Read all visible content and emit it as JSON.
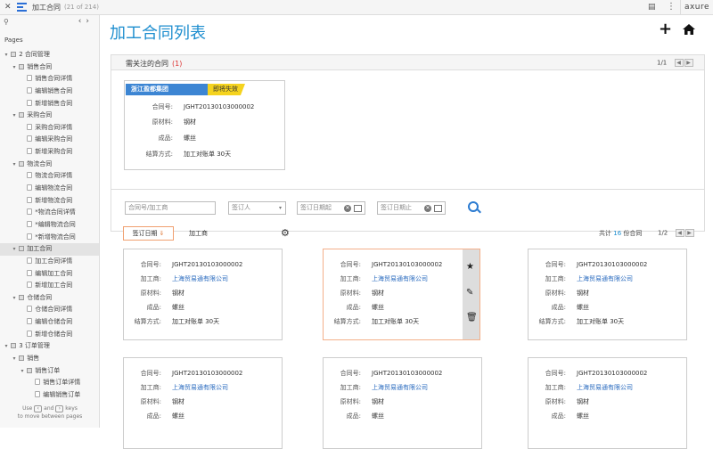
{
  "topbar": {
    "close_icon": "close-icon",
    "title": "加工合同",
    "count": "(21 of 214)",
    "brand": "axure"
  },
  "sidebar": {
    "pages_label": "Pages",
    "tree": [
      {
        "label": "2 合同管理",
        "level": 0,
        "type": "folder"
      },
      {
        "label": "销售合同",
        "level": 1,
        "type": "folder"
      },
      {
        "label": "销售合同详情",
        "level": 2,
        "type": "page"
      },
      {
        "label": "编辑销售合同",
        "level": 2,
        "type": "page"
      },
      {
        "label": "新增销售合同",
        "level": 2,
        "type": "page"
      },
      {
        "label": "采购合同",
        "level": 1,
        "type": "folder"
      },
      {
        "label": "采购合同详情",
        "level": 2,
        "type": "page"
      },
      {
        "label": "编辑采购合同",
        "level": 2,
        "type": "page"
      },
      {
        "label": "新增采购合同",
        "level": 2,
        "type": "page"
      },
      {
        "label": "物流合同",
        "level": 1,
        "type": "folder"
      },
      {
        "label": "物流合同详情",
        "level": 2,
        "type": "page"
      },
      {
        "label": "编辑物流合同",
        "level": 2,
        "type": "page"
      },
      {
        "label": "新增物流合同",
        "level": 2,
        "type": "page"
      },
      {
        "label": "*物流合同详情",
        "level": 2,
        "type": "page"
      },
      {
        "label": "*编辑物流合同",
        "level": 2,
        "type": "page"
      },
      {
        "label": "*新增物流合同",
        "level": 2,
        "type": "page"
      },
      {
        "label": "加工合同",
        "level": 1,
        "type": "folder",
        "selected": true
      },
      {
        "label": "加工合同详情",
        "level": 2,
        "type": "page"
      },
      {
        "label": "编辑加工合同",
        "level": 2,
        "type": "page"
      },
      {
        "label": "新增加工合同",
        "level": 2,
        "type": "page"
      },
      {
        "label": "仓储合同",
        "level": 1,
        "type": "folder"
      },
      {
        "label": "仓储合同详情",
        "level": 2,
        "type": "page"
      },
      {
        "label": "编辑仓储合同",
        "level": 2,
        "type": "page"
      },
      {
        "label": "新增仓储合同",
        "level": 2,
        "type": "page"
      },
      {
        "label": "3 订单管理",
        "level": 0,
        "type": "folder"
      },
      {
        "label": "销售",
        "level": 1,
        "type": "folder"
      },
      {
        "label": "销售订单",
        "level": 2,
        "type": "folder"
      },
      {
        "label": "销售订单详情",
        "level": 3,
        "type": "page"
      },
      {
        "label": "编辑销售订单",
        "level": 3,
        "type": "page"
      }
    ],
    "footer_use": "Use",
    "footer_and": "and",
    "footer_keys": "keys",
    "footer_line2": "to move between pages"
  },
  "main": {
    "title": "加工合同列表",
    "add_icon": "plus-icon",
    "home_icon": "home-icon",
    "attention": {
      "title": "需关注的合同",
      "count": "(1)",
      "page": "1/1",
      "card": {
        "company": "浙江盈都集团",
        "status": "即将失效",
        "rows": [
          {
            "label": "合同号:",
            "value": "JGHT20130103000002"
          },
          {
            "label": "原材料:",
            "value": "钢材"
          },
          {
            "label": "成品:",
            "value": "螺丝"
          },
          {
            "label": "结算方式:",
            "value": "加工对账单   30天"
          }
        ]
      }
    },
    "filters": {
      "contract_placeholder": "合同号/加工商",
      "signer_placeholder": "签订人",
      "date_start_placeholder": "签订日期起",
      "date_end_placeholder": "签订日期止"
    },
    "sort": {
      "sort_date": "签订日期",
      "sort_arrow": "⇓",
      "sort_vendor": "加工商",
      "total_prefix": "共计",
      "total_count": "16",
      "total_suffix": "份合同",
      "page": "1/2"
    },
    "cards": [
      {
        "contract": "JGHT20130103000002",
        "vendor": "上海贸易通有限公司",
        "material": "钢材",
        "product": "螺丝",
        "settlement": "加工对账单   30天"
      },
      {
        "contract": "JGHT20130103000002",
        "vendor": "上海贸易通有限公司",
        "material": "钢材",
        "product": "螺丝",
        "settlement": "加工对账单   30天",
        "active": true
      },
      {
        "contract": "JGHT20130103000002",
        "vendor": "上海贸易通有限公司",
        "material": "钢材",
        "product": "螺丝",
        "settlement": "加工对账单   30天"
      },
      {
        "contract": "JGHT20130103000002",
        "vendor": "上海贸易通有限公司",
        "material": "钢材",
        "product": "螺丝"
      },
      {
        "contract": "JGHT20130103000002",
        "vendor": "上海贸易通有限公司",
        "material": "钢材",
        "product": "螺丝"
      },
      {
        "contract": "JGHT20130103000002",
        "vendor": "上海贸易通有限公司",
        "material": "钢材",
        "product": "螺丝"
      }
    ],
    "card_labels": {
      "contract": "合同号:",
      "vendor": "加工商:",
      "material": "原材料:",
      "product": "成品:",
      "settlement": "结算方式:"
    }
  }
}
